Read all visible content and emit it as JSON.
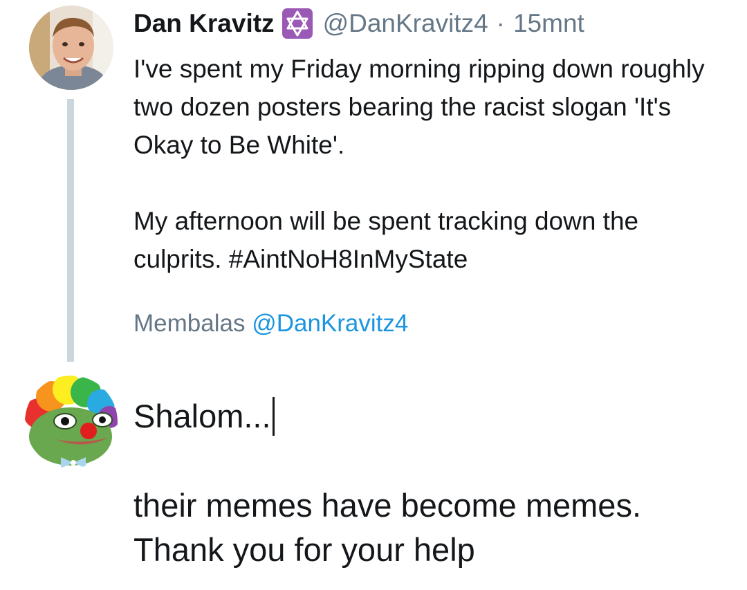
{
  "original_tweet": {
    "author": {
      "display_name": "Dan Kravitz",
      "badge_icon": "star-of-david-icon",
      "badge_color": "#9b59b6",
      "handle": "@DanKravitz4"
    },
    "separator": "·",
    "timestamp": "15mnt",
    "text_paragraph_1": "I've spent my Friday morning ripping down roughly two dozen posters bearing the racist slogan 'It's Okay to Be White'.",
    "text_paragraph_2_prefix": "My afternoon will be spent tracking down the culprits. ",
    "hashtag": "#AintNoH8InMyState",
    "reply_label": "Membalas",
    "reply_handle": "@DanKravitz4"
  },
  "reply_compose": {
    "line_1": "Shalom...",
    "line_2": "their memes have become memes. Thank you for your help"
  },
  "colors": {
    "text_primary": "#14171a",
    "text_secondary": "#657786",
    "link": "#1b95e0",
    "thread_line": "#ccd6dd"
  }
}
